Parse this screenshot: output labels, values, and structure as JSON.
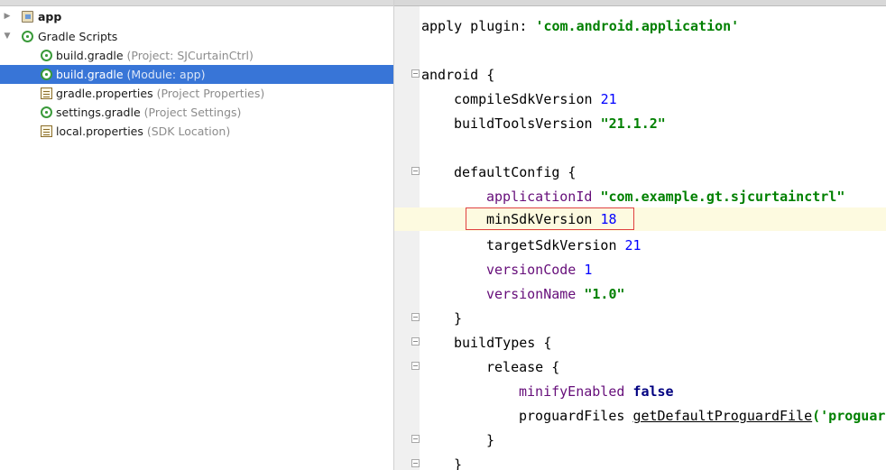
{
  "project_tree": [
    {
      "label": "app",
      "hint": "",
      "icon": "folder-icon",
      "bold": true,
      "arrow": "▶"
    },
    {
      "label": "Gradle Scripts",
      "hint": "",
      "icon": "gradle-icon",
      "bold": false,
      "arrow": "▼"
    },
    {
      "label": "build.gradle",
      "hint": "(Project: SJCurtainCtrl)",
      "icon": "gradle-icon",
      "bold": false,
      "arrow": ""
    },
    {
      "label": "build.gradle",
      "hint": "(Module: app)",
      "icon": "gradle-icon",
      "bold": false,
      "arrow": "",
      "selected": true
    },
    {
      "label": "gradle.properties",
      "hint": "(Project Properties)",
      "icon": "properties-file-icon",
      "bold": false,
      "arrow": ""
    },
    {
      "label": "settings.gradle",
      "hint": "(Project Settings)",
      "icon": "gradle-icon",
      "bold": false,
      "arrow": ""
    },
    {
      "label": "local.properties",
      "hint": "(SDK Location)",
      "icon": "properties-file-icon",
      "bold": false,
      "arrow": ""
    }
  ],
  "code": {
    "apply": "apply plugin: ",
    "apply_val": "'com.android.application'",
    "android": "android {",
    "compile_key": "compileSdkVersion ",
    "compile_val": "21",
    "build_tools_key": "buildToolsVersion ",
    "build_tools_val": "\"21.1.2\"",
    "default_config": "defaultConfig {",
    "app_id_key": "applicationId ",
    "app_id_val": "\"com.example.gt.sjcurtainctrl\"",
    "min_sdk_key": "minSdkVersion ",
    "min_sdk_val": "18",
    "target_sdk_key": "targetSdkVersion ",
    "target_sdk_val": "21",
    "version_code_key": "versionCode ",
    "version_code_val": "1",
    "version_name_key": "versionName ",
    "version_name_val": "\"1.0\"",
    "close_brace": "}",
    "build_types": "buildTypes {",
    "release": "release {",
    "minify_key": "minifyEnabled ",
    "minify_val": "false",
    "proguard_key": "proguardFiles ",
    "proguard_fn": "getDefaultProguardFile",
    "proguard_rest": "('proguard-android.txt'), 'proguard-rules.pro'"
  },
  "colors": {
    "selection": "#3875d7",
    "highlight_box": "#e04040",
    "string": "#008000",
    "keyword": "#000080",
    "property": "#660e7a",
    "number": "#0000ff"
  }
}
